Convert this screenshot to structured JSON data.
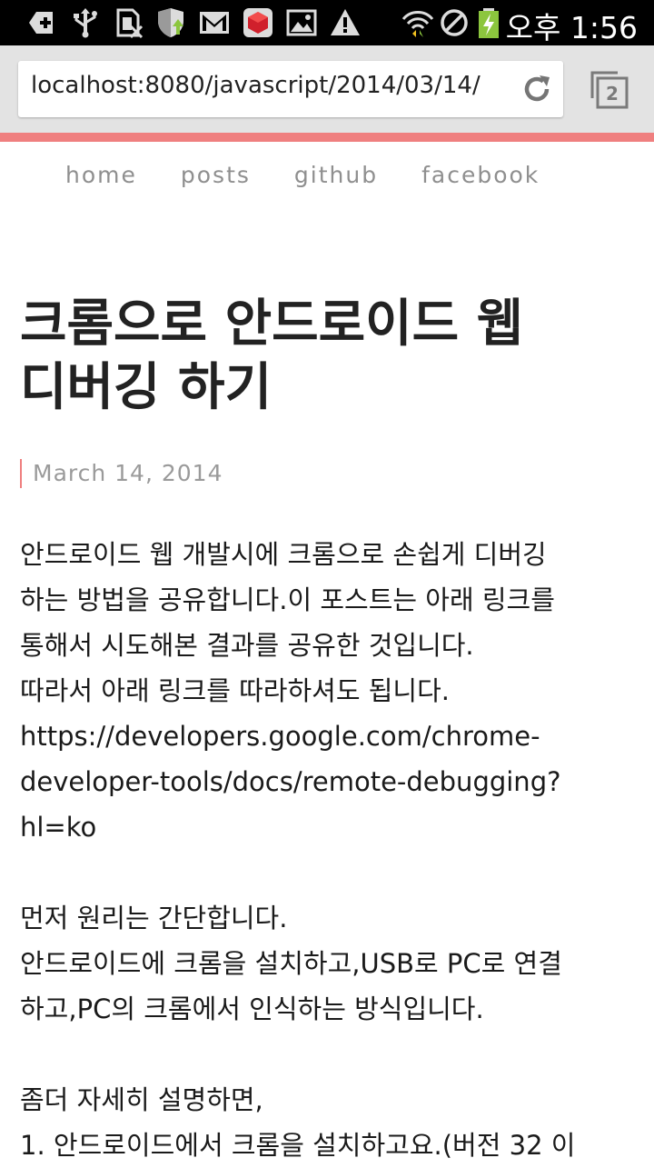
{
  "status_bar": {
    "time": "오후 1:56",
    "icons": [
      "add-box-icon",
      "usb-icon",
      "sim-blocked-icon",
      "shield-icon",
      "gmail-icon",
      "ruby-app-icon",
      "image-icon",
      "warning-icon",
      "wifi-icon",
      "do-not-disturb-icon",
      "battery-charging-icon"
    ],
    "colors": {
      "background": "#000000",
      "text": "#ffffff",
      "battery": "#8cc63e"
    }
  },
  "browser": {
    "url": "localhost:8080/javascript/2014/03/14/",
    "tab_count": "2",
    "reload_icon": "reload-icon",
    "tabs_icon": "tab-switcher-icon"
  },
  "nav": {
    "items": [
      {
        "label": "home"
      },
      {
        "label": "posts"
      },
      {
        "label": "github"
      },
      {
        "label": "facebook"
      }
    ]
  },
  "post": {
    "title_line1": "크롬으로 안드로이드 웹",
    "title_line2": "디버깅 하기",
    "date": "March 14, 2014",
    "lines": [
      "안드로이드 웹 개발시에 크롬으로 손쉽게 디버깅",
      "하는 방법을 공유합니다.이 포스트는 아래 링크를",
      "통해서 시도해본 결과를 공유한 것입니다.",
      "따라서 아래 링크를 따라하셔도 됩니다.",
      "https://developers.google.com/chrome-",
      "developer-tools/docs/remote-debugging?",
      "hl=ko",
      "",
      "먼저 원리는 간단합니다.",
      "안드로이드에 크롬을 설치하고,USB로 PC로 연결",
      "하고,PC의 크롬에서 인식하는 방식입니다.",
      "",
      "좀더 자세히 설명하면,",
      "1. 안드로이드에서 크롬을 설치하고요.(버전 32 이"
    ]
  },
  "colors": {
    "accent": "#ef7f7f",
    "nav_text": "#8f8f8f",
    "body_text": "#1a1a1a"
  }
}
